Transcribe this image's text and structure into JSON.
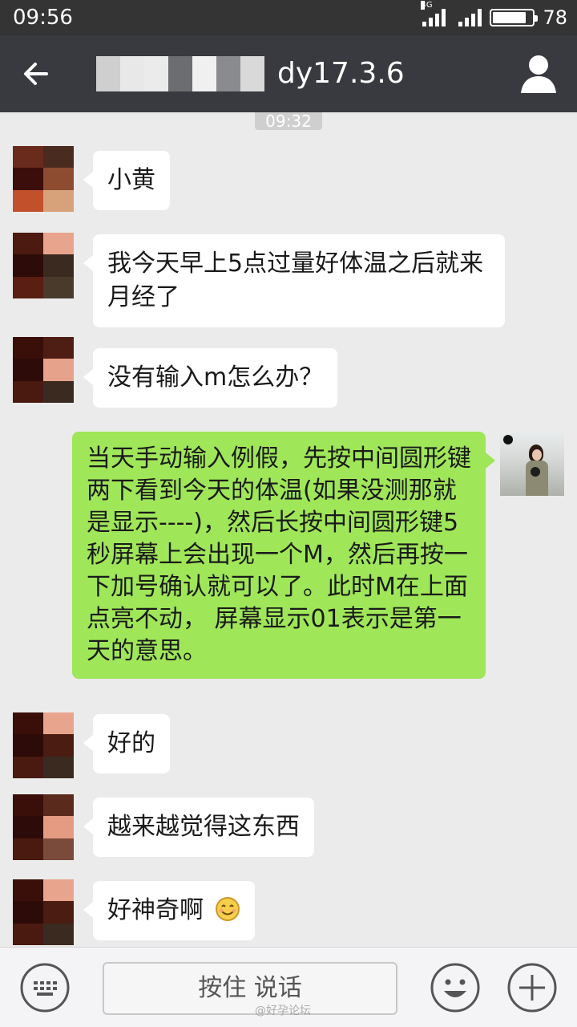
{
  "status_bar": {
    "time": "09:56",
    "network": "4G",
    "battery": "78"
  },
  "header": {
    "title": "dy17.3.6",
    "back_icon": "back-arrow-icon",
    "profile_icon": "person-icon"
  },
  "chat": {
    "timestamp": "09:32",
    "messages": [
      {
        "side": "left",
        "text": "小黄"
      },
      {
        "side": "left",
        "text": "我今天早上5点过量好体温之后就来月经了"
      },
      {
        "side": "left",
        "text": "没有输入m怎么办？"
      },
      {
        "side": "right",
        "text": "当天手动输入例假，先按中间圆形键两下看到今天的体温(如果没测那就是显示----)，然后长按中间圆形键5秒屏幕上会出现一个M，然后再按一下加号确认就可以了。此时M在上面点亮不动， 屏幕显示01表示是第一天的意思。"
      },
      {
        "side": "left",
        "text": "好的"
      },
      {
        "side": "left",
        "text": "越来越觉得这东西"
      },
      {
        "side": "left",
        "text": "好神奇啊",
        "emoji": "smiley-emoji"
      }
    ]
  },
  "input_bar": {
    "hold_to_talk": "按住 说话",
    "keyboard_icon": "keyboard-icon",
    "emoji_icon": "emoji-icon",
    "plus_icon": "plus-icon",
    "watermark": "@好孕论坛"
  },
  "colors": {
    "status_bar_bg": "#343434",
    "title_bar_bg": "#393a3f",
    "chat_bg": "#ebebeb",
    "incoming_bubble": "#ffffff",
    "outgoing_bubble": "#9fe658"
  }
}
